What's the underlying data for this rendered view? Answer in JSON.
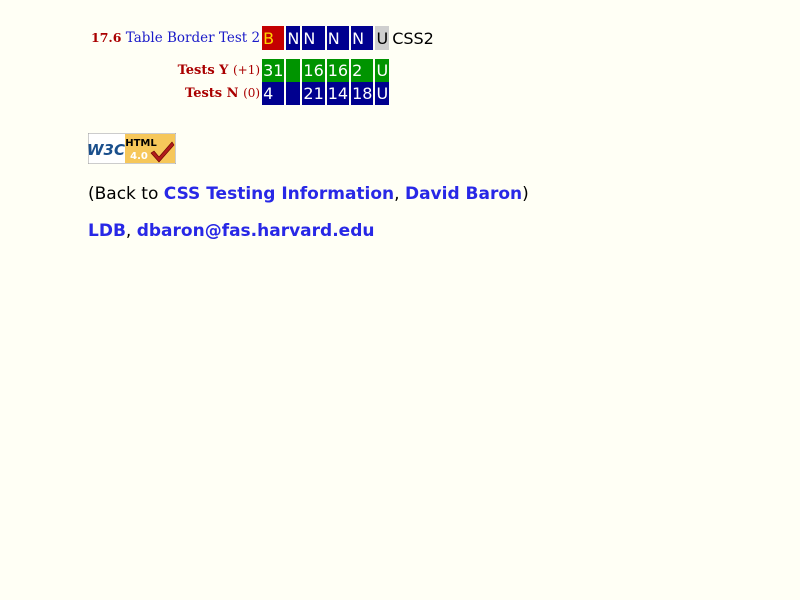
{
  "header": {
    "section_number": "17.6",
    "title": "Table Border Test 2",
    "cells": [
      {
        "text": "B",
        "kind": "B"
      },
      {
        "text": "N",
        "kind": "N"
      },
      {
        "text": "N",
        "kind": "N"
      },
      {
        "text": "N",
        "kind": "N"
      },
      {
        "text": "N",
        "kind": "N"
      },
      {
        "text": "U",
        "kind": "U"
      },
      {
        "text": "CSS2",
        "kind": "txt"
      }
    ]
  },
  "rows": [
    {
      "label": "Tests Y",
      "sub": "(+1)",
      "cells": [
        "31",
        "",
        "16",
        "16",
        "2",
        "U"
      ],
      "color": "green"
    },
    {
      "label": "Tests N",
      "sub": "(0)",
      "cells": [
        "4",
        "",
        "21",
        "14",
        "18",
        "U"
      ],
      "color": "blue"
    }
  ],
  "badge": {
    "left_text": "W3C",
    "top_text": "HTML",
    "version": "4.0"
  },
  "nav": {
    "prefix": "(Back to ",
    "link1": "CSS Testing Information",
    "sep": ", ",
    "link2": "David Baron",
    "suffix": ")"
  },
  "footer": {
    "link1": "LDB",
    "sep": ", ",
    "link2": "dbaron@fas.harvard.edu"
  },
  "colors": {
    "background": "#fffff5",
    "link": "#2828e6",
    "red": "#c40000",
    "navy": "#00008f",
    "green": "#009400",
    "gray": "#cfcfcf"
  }
}
